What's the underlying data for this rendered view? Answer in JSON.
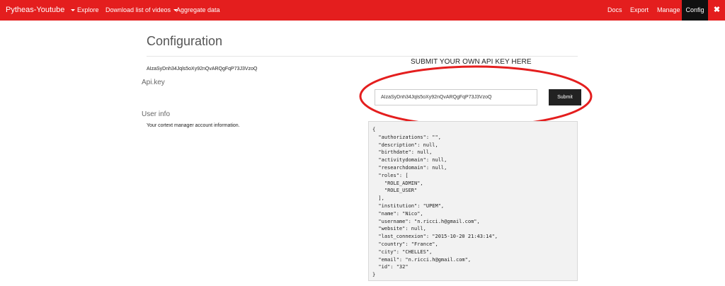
{
  "navbar": {
    "brand": "Pytheas-Youtube",
    "left_items": [
      "Explore",
      "Download list of videos",
      "Aggregate data"
    ],
    "right_items": [
      "Docs",
      "Export",
      "Manage",
      "Config"
    ],
    "active_item": "Config",
    "close_glyph": "✖",
    "colors": {
      "background": "#e41e1e",
      "active": "#111111"
    }
  },
  "page": {
    "title": "Configuration",
    "current_api_key": "AIzaSyDnh34Jqls5oXy92nQvARQgFqP73J3VzoQ",
    "annotation": "SUBMIT YOUR OWN API KEY HERE",
    "annotation_color": "#e41e1e"
  },
  "api_key": {
    "label": "Api.key",
    "input_value": "AIzaSyDnh34Jqls5oXy92nQvARQgFqP73J3VzoQ",
    "submit_label": "Submit"
  },
  "user_info": {
    "label": "User info",
    "description": "Your cortext manager account information.",
    "json": "{\n  \"authorizations\": \"\",\n  \"description\": null,\n  \"birthdate\": null,\n  \"activitydomain\": null,\n  \"researchdomain\": null,\n  \"roles\": [\n    \"ROLE_ADMIN\",\n    \"ROLE_USER\"\n  ],\n  \"institution\": \"UPEM\",\n  \"name\": \"Nico\",\n  \"username\": \"n.ricci.h@gmail.com\",\n  \"website\": null,\n  \"last_connexion\": \"2015-10-20 21:43:14\",\n  \"country\": \"France\",\n  \"city\": \"CHELLES\",\n  \"email\": \"n.ricci.h@gmail.com\",\n  \"id\": \"32\"\n}"
  }
}
